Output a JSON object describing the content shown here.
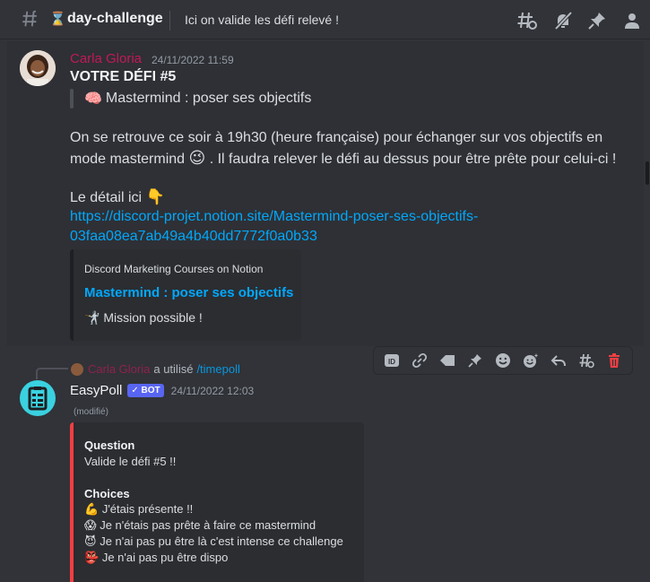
{
  "header": {
    "channel_emoji": "⌛",
    "channel_name": "day-challenge",
    "topic": "Ici on valide les défi relevé !"
  },
  "message1": {
    "author": "Carla Gloria",
    "author_color": "#c2185b",
    "timestamp": "24/11/2022 11:59",
    "title": "VOTRE DÉFI #5",
    "quote_emoji": "🧠",
    "quote_text": "Mastermind : poser ses objectifs",
    "line1": "On se retrouve ce soir à 19h30 (heure française) pour échanger sur vos objectifs en",
    "line2a": "mode mastermind",
    "line2_emoji": "😉",
    "line2b": ". Il faudra relever le défi au dessus pour être prête pour celui-ci !",
    "detail_text": "Le détail ici",
    "detail_emoji": "👇",
    "link_line1": "https://discord-projet.notion.site/Mastermind-poser-ses-objectifs-",
    "link_line2": "03faa08ea7ab49a4b40dd7772f0a0b33",
    "embed": {
      "provider": "Discord Marketing Courses on Notion",
      "title": "Mastermind : poser ses objectifs",
      "desc_emoji": "🤺",
      "description": "Mission possible !"
    }
  },
  "message2": {
    "reply_author": "Carla Gloria",
    "reply_used": "a utilisé",
    "reply_command": "/timepoll",
    "author": "EasyPoll",
    "bot_label": "BOT",
    "timestamp": "24/11/2022 12:03",
    "edited": "(modifié)",
    "embed": {
      "accent": "#f23f43",
      "question_label": "Question",
      "question": "Valide le défi #5 !!",
      "choices_label": "Choices",
      "choices": [
        {
          "emoji": "💪",
          "text": "J'étais présente !!"
        },
        {
          "emoji": "😱",
          "text": "Je n'étais pas prête à faire ce mastermind"
        },
        {
          "emoji": "😈",
          "text": "Je n'ai pas pu être là c'est intense ce challenge"
        },
        {
          "emoji": "👺",
          "text": "Je n'ai pas pu être dispo"
        }
      ]
    }
  },
  "colors": {
    "background": "#313338",
    "link": "#00a8fc",
    "blurple": "#5865f2",
    "danger": "#f23f43"
  }
}
